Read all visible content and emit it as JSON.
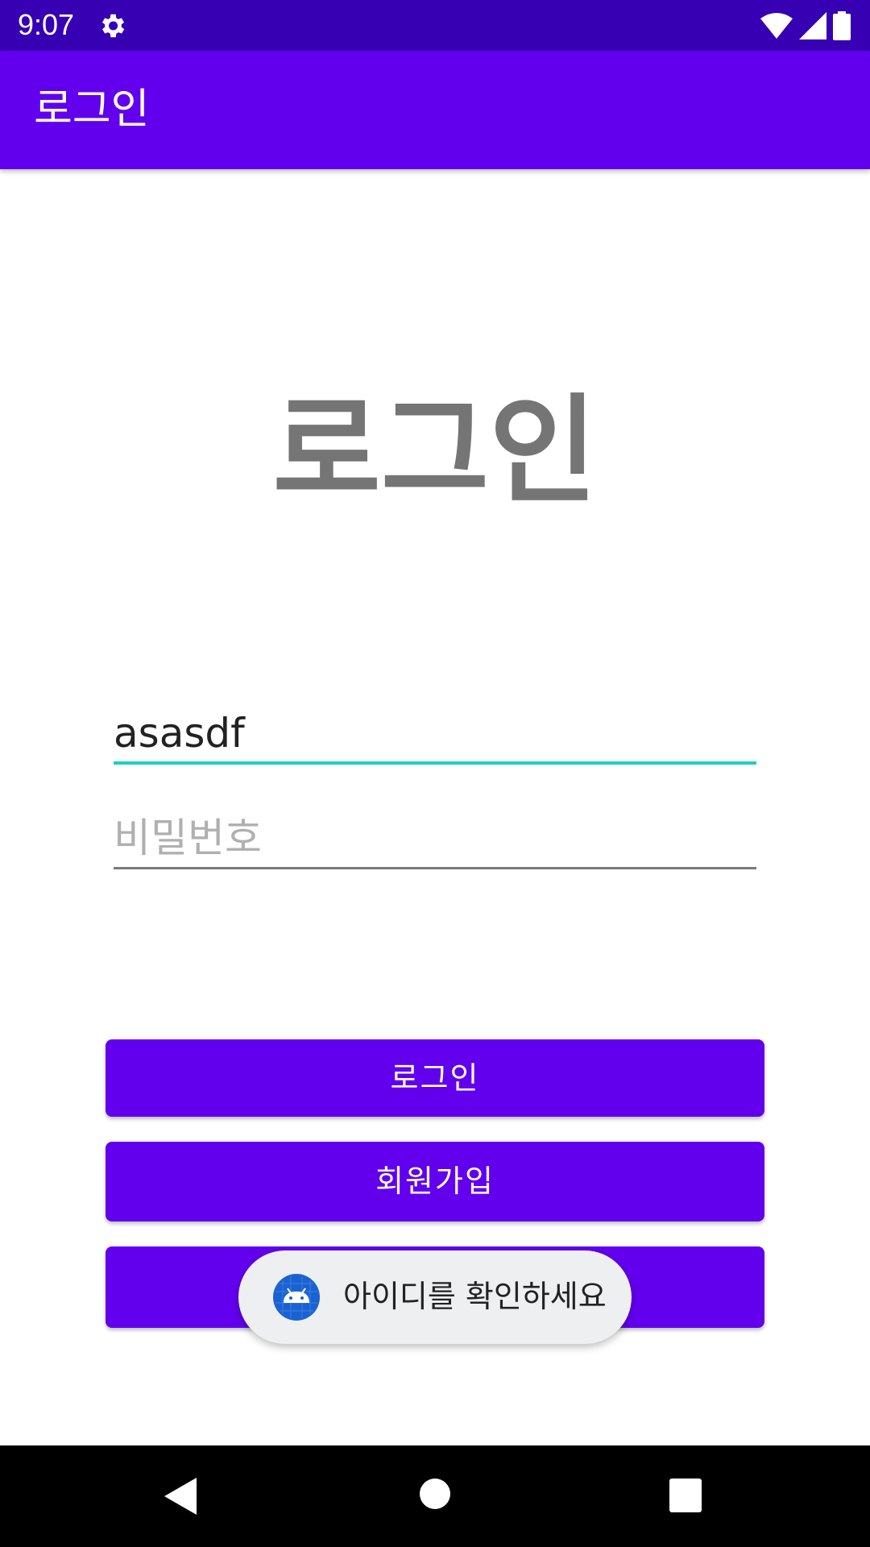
{
  "status_bar": {
    "time": "9:07",
    "icons": [
      "gear-icon",
      "wifi-icon",
      "cell-signal-icon",
      "battery-icon"
    ]
  },
  "app_bar": {
    "title": "로그인"
  },
  "main": {
    "heading": "로그인",
    "id_field": {
      "value": "asasdf",
      "underline_color": "#1ad1c6"
    },
    "password_field": {
      "placeholder": "비밀번호"
    },
    "buttons": {
      "login_label": "로그인",
      "signup_label": "회원가입",
      "third_label": ""
    }
  },
  "toast": {
    "icon": "android-icon",
    "message": "아이디를 확인하세요"
  },
  "nav_bar": {
    "icons": [
      "back-icon",
      "home-icon",
      "recents-icon"
    ]
  },
  "colors": {
    "status_bar": "#3700b3",
    "primary": "#6200ee",
    "heading_gray": "#757575"
  }
}
